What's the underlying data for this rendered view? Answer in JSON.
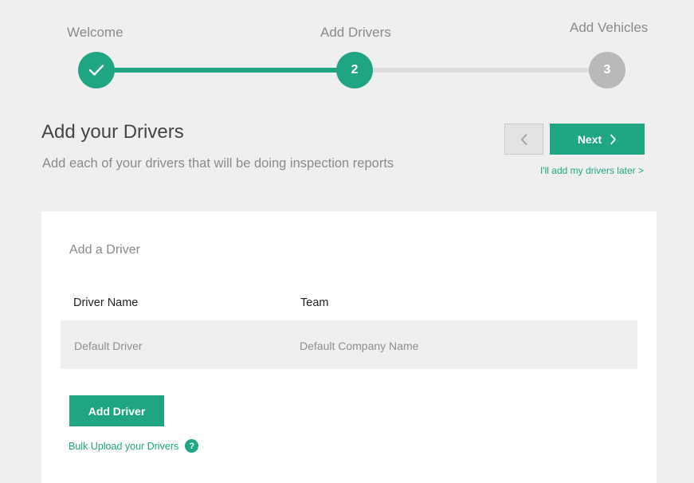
{
  "wizard": {
    "steps": [
      {
        "label": "Welcome",
        "status": "complete",
        "icon": "check-icon"
      },
      {
        "label": "Add Drivers",
        "status": "active",
        "number": "2"
      },
      {
        "label": "Add Vehicles",
        "status": "upcoming",
        "number": "3"
      }
    ],
    "accent_color": "#20a583",
    "inactive_color": "#b9b9b9"
  },
  "header": {
    "title": "Add your Drivers",
    "subtitle": "Add each of your drivers that will be doing inspection reports"
  },
  "nav": {
    "back_icon": "chevron-left-icon",
    "next_label": "Next",
    "next_icon": "chevron-right-icon",
    "later_link": "I'll add my drivers later >"
  },
  "card": {
    "title": "Add a Driver",
    "columns": [
      "Driver Name",
      "Team"
    ],
    "rows": [
      {
        "driver_name": "Default Driver",
        "team": "Default Company Name"
      }
    ],
    "add_button": "Add Driver",
    "bulk_link": "Bulk Upload your Drivers",
    "help_glyph": "?"
  }
}
